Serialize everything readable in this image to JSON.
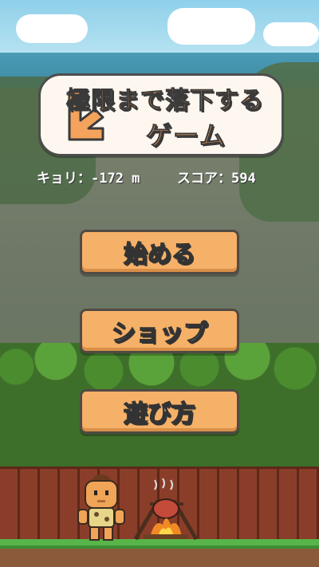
{
  "title": {
    "line1": "極限まで落下する",
    "line2": "ゲーム"
  },
  "stats": {
    "distance": "キョリ：-172 m",
    "score": "スコア：594"
  },
  "menu": {
    "start_label": "始める",
    "shop_label": "ショップ",
    "howto_label": "遊び方"
  },
  "icons": {
    "title_arrow": "down-right-arrow-icon",
    "player": "caveman-character",
    "fire": "campfire-icon"
  },
  "colors": {
    "button_fill": "#f6b168",
    "button_border": "#514a44",
    "title_text": "#f3a35c",
    "panel_bg": "#fdf7ef"
  }
}
